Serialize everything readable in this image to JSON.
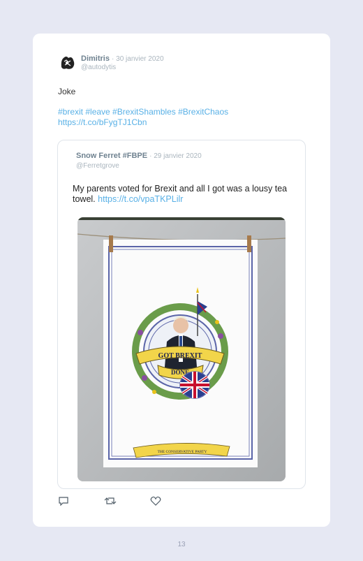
{
  "tweet": {
    "author_name": "Dimitris",
    "date": "· 30 janvier 2020",
    "handle": "@autodytis",
    "text": "Joke",
    "hashtags": "#brexit #leave #BrexitShambles #BrexitChaos",
    "link": "https://t.co/bFygTJ1Cbn"
  },
  "quoted_tweet": {
    "author_name": "Snow Ferret #FBPE",
    "date": "· 29 janvier 2020",
    "handle": "@Ferretgrove",
    "text": "My parents voted for Brexit and all I got was a lousy tea towel.",
    "link": "https://t.co/vpaTKPLilr",
    "image": {
      "banner_text": "GOT BREXIT",
      "banner_text_2": "DONE",
      "ribbon_text": "THE CONSERVATIVE PARTY"
    }
  },
  "actions": {
    "icons": [
      "reply-icon",
      "retweet-icon",
      "like-icon"
    ]
  },
  "page_number": "13"
}
